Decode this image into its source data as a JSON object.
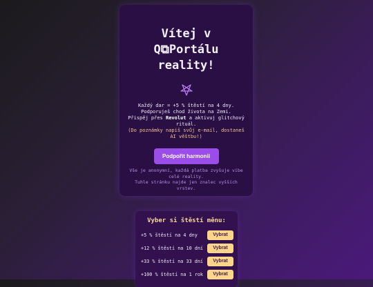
{
  "card": {
    "title_line1": "Vítej v",
    "title_line2_prefix": "Q",
    "title_line2_glyph": "⧉",
    "title_line2_suffix": "Portálu",
    "title_line3": "reality!",
    "star_icon": "pentagram-icon",
    "desc_line1": "Každý dar = +5 % štěstí na 4 dny.",
    "desc_line2": "Podporuješ chod života na Zemi.",
    "desc_line3_pre": "Přispěj přes ",
    "desc_line3_brand": "Revolut",
    "desc_line3_post": " a aktivuj glitchový rituál.",
    "desc_hint": "(Do poznámky napiš svůj e-mail, dostaneš AI věštbu!)",
    "support_button": "Podpořit harmonii",
    "note_line1": "Vše je anonymní, každá platba zvyšuje vibe celé reality.",
    "note_line2": "Tuhle stránku najde jen znalec vyšších vrstev."
  },
  "menu": {
    "title": "Vyber si štěstí měnu:",
    "options": [
      {
        "label": "+5 % štěstí na 4 dny",
        "button": "Vybrat"
      },
      {
        "label": "+12 % štěstí na 10 dní",
        "button": "Vybrat"
      },
      {
        "label": "+33 % štěstí na 33 dní",
        "button": "Vybrat"
      },
      {
        "label": "+100 % štěstí na 1 rok",
        "button": "Vybrat"
      }
    ]
  },
  "colors": {
    "card_bg": "#2a0f45",
    "button_purple": "#9b4dea",
    "pick_button": "#ffd58a",
    "hint_text": "#f2c38b"
  }
}
